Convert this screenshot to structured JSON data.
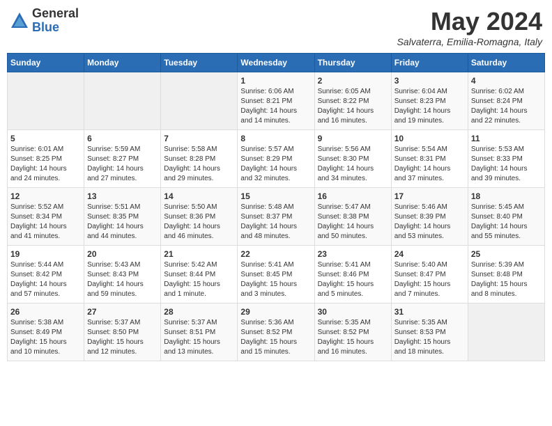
{
  "header": {
    "logo_general": "General",
    "logo_blue": "Blue",
    "month": "May 2024",
    "location": "Salvaterra, Emilia-Romagna, Italy"
  },
  "days_of_week": [
    "Sunday",
    "Monday",
    "Tuesday",
    "Wednesday",
    "Thursday",
    "Friday",
    "Saturday"
  ],
  "weeks": [
    [
      {
        "day": "",
        "info": ""
      },
      {
        "day": "",
        "info": ""
      },
      {
        "day": "",
        "info": ""
      },
      {
        "day": "1",
        "info": "Sunrise: 6:06 AM\nSunset: 8:21 PM\nDaylight: 14 hours\nand 14 minutes."
      },
      {
        "day": "2",
        "info": "Sunrise: 6:05 AM\nSunset: 8:22 PM\nDaylight: 14 hours\nand 16 minutes."
      },
      {
        "day": "3",
        "info": "Sunrise: 6:04 AM\nSunset: 8:23 PM\nDaylight: 14 hours\nand 19 minutes."
      },
      {
        "day": "4",
        "info": "Sunrise: 6:02 AM\nSunset: 8:24 PM\nDaylight: 14 hours\nand 22 minutes."
      }
    ],
    [
      {
        "day": "5",
        "info": "Sunrise: 6:01 AM\nSunset: 8:25 PM\nDaylight: 14 hours\nand 24 minutes."
      },
      {
        "day": "6",
        "info": "Sunrise: 5:59 AM\nSunset: 8:27 PM\nDaylight: 14 hours\nand 27 minutes."
      },
      {
        "day": "7",
        "info": "Sunrise: 5:58 AM\nSunset: 8:28 PM\nDaylight: 14 hours\nand 29 minutes."
      },
      {
        "day": "8",
        "info": "Sunrise: 5:57 AM\nSunset: 8:29 PM\nDaylight: 14 hours\nand 32 minutes."
      },
      {
        "day": "9",
        "info": "Sunrise: 5:56 AM\nSunset: 8:30 PM\nDaylight: 14 hours\nand 34 minutes."
      },
      {
        "day": "10",
        "info": "Sunrise: 5:54 AM\nSunset: 8:31 PM\nDaylight: 14 hours\nand 37 minutes."
      },
      {
        "day": "11",
        "info": "Sunrise: 5:53 AM\nSunset: 8:33 PM\nDaylight: 14 hours\nand 39 minutes."
      }
    ],
    [
      {
        "day": "12",
        "info": "Sunrise: 5:52 AM\nSunset: 8:34 PM\nDaylight: 14 hours\nand 41 minutes."
      },
      {
        "day": "13",
        "info": "Sunrise: 5:51 AM\nSunset: 8:35 PM\nDaylight: 14 hours\nand 44 minutes."
      },
      {
        "day": "14",
        "info": "Sunrise: 5:50 AM\nSunset: 8:36 PM\nDaylight: 14 hours\nand 46 minutes."
      },
      {
        "day": "15",
        "info": "Sunrise: 5:48 AM\nSunset: 8:37 PM\nDaylight: 14 hours\nand 48 minutes."
      },
      {
        "day": "16",
        "info": "Sunrise: 5:47 AM\nSunset: 8:38 PM\nDaylight: 14 hours\nand 50 minutes."
      },
      {
        "day": "17",
        "info": "Sunrise: 5:46 AM\nSunset: 8:39 PM\nDaylight: 14 hours\nand 53 minutes."
      },
      {
        "day": "18",
        "info": "Sunrise: 5:45 AM\nSunset: 8:40 PM\nDaylight: 14 hours\nand 55 minutes."
      }
    ],
    [
      {
        "day": "19",
        "info": "Sunrise: 5:44 AM\nSunset: 8:42 PM\nDaylight: 14 hours\nand 57 minutes."
      },
      {
        "day": "20",
        "info": "Sunrise: 5:43 AM\nSunset: 8:43 PM\nDaylight: 14 hours\nand 59 minutes."
      },
      {
        "day": "21",
        "info": "Sunrise: 5:42 AM\nSunset: 8:44 PM\nDaylight: 15 hours\nand 1 minute."
      },
      {
        "day": "22",
        "info": "Sunrise: 5:41 AM\nSunset: 8:45 PM\nDaylight: 15 hours\nand 3 minutes."
      },
      {
        "day": "23",
        "info": "Sunrise: 5:41 AM\nSunset: 8:46 PM\nDaylight: 15 hours\nand 5 minutes."
      },
      {
        "day": "24",
        "info": "Sunrise: 5:40 AM\nSunset: 8:47 PM\nDaylight: 15 hours\nand 7 minutes."
      },
      {
        "day": "25",
        "info": "Sunrise: 5:39 AM\nSunset: 8:48 PM\nDaylight: 15 hours\nand 8 minutes."
      }
    ],
    [
      {
        "day": "26",
        "info": "Sunrise: 5:38 AM\nSunset: 8:49 PM\nDaylight: 15 hours\nand 10 minutes."
      },
      {
        "day": "27",
        "info": "Sunrise: 5:37 AM\nSunset: 8:50 PM\nDaylight: 15 hours\nand 12 minutes."
      },
      {
        "day": "28",
        "info": "Sunrise: 5:37 AM\nSunset: 8:51 PM\nDaylight: 15 hours\nand 13 minutes."
      },
      {
        "day": "29",
        "info": "Sunrise: 5:36 AM\nSunset: 8:52 PM\nDaylight: 15 hours\nand 15 minutes."
      },
      {
        "day": "30",
        "info": "Sunrise: 5:35 AM\nSunset: 8:52 PM\nDaylight: 15 hours\nand 16 minutes."
      },
      {
        "day": "31",
        "info": "Sunrise: 5:35 AM\nSunset: 8:53 PM\nDaylight: 15 hours\nand 18 minutes."
      },
      {
        "day": "",
        "info": ""
      }
    ]
  ]
}
